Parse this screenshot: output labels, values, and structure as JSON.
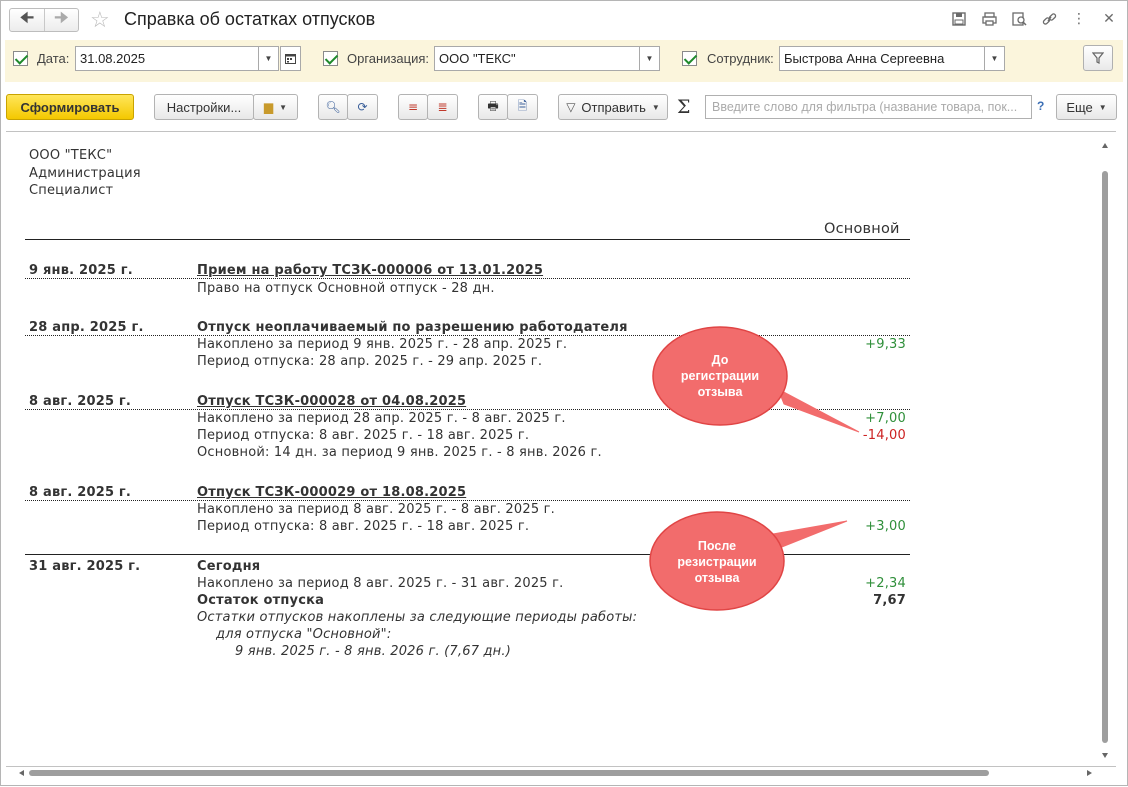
{
  "window": {
    "title": "Справка об остатках отпусков"
  },
  "filters": {
    "date_label": "Дата:",
    "date_value": "31.08.2025",
    "org_label": "Организация:",
    "org_value": "ООО \"ТЕКС\"",
    "employee_label": "Сотрудник:",
    "employee_value": "Быстрова Анна Сергеевна"
  },
  "toolbar": {
    "generate": "Сформировать",
    "settings": "Настройки...",
    "send": "Отправить",
    "search_placeholder": "Введите слово для фильтра (название товара, пок...",
    "help": "?",
    "more": "Еще"
  },
  "report": {
    "header": [
      "ООО \"ТЕКС\"",
      "Администрация",
      "Специалист"
    ],
    "column_title": "Основной",
    "entries": [
      {
        "date": "9 янв. 2025 г.",
        "title": "Прием на работу ТСЗК-000006 от 13.01.2025",
        "lines": [
          "Право на отпуск Основной отпуск - 28 дн."
        ]
      },
      {
        "date": "28 апр. 2025 г.",
        "title": "Отпуск неоплачиваемый по разрешению работодателя",
        "lines": [
          "Накоплено за период 9 янв. 2025 г. - 28 апр. 2025 г.",
          "Период отпуска: 28 апр. 2025 г. - 29 апр. 2025 г."
        ],
        "values": [
          "+9,33"
        ]
      },
      {
        "date": "8 авг. 2025 г.",
        "title": "Отпуск ТСЗК-000028 от 04.08.2025",
        "lines": [
          "Накоплено за период 28 апр. 2025 г. - 8 авг. 2025 г.",
          "Период отпуска: 8 авг. 2025 г. - 18 авг. 2025 г.",
          "Основной: 14 дн. за период 9 янв. 2025 г. - 8 янв. 2026 г."
        ],
        "values": [
          "+7,00",
          "-14,00"
        ]
      },
      {
        "date": "8 авг. 2025 г.",
        "title": "Отпуск ТСЗК-000029 от 18.08.2025",
        "lines": [
          "Накоплено за период 8 авг. 2025 г. - 8 авг. 2025 г.",
          "Период отпуска: 8 авг. 2025 г. - 18 авг. 2025 г."
        ],
        "values": [
          "+3,00"
        ]
      },
      {
        "date": "31 авг. 2025 г.",
        "title": "Сегодня",
        "lines": [
          "Накоплено за период 8 авг. 2025 г. - 31 авг. 2025 г."
        ],
        "values": [
          "+2,34"
        ],
        "remainder_label": "Остаток отпуска",
        "remainder_value": "7,67",
        "notes": [
          "Остатки отпусков накоплены за следующие периоды работы:",
          "для отпуска \"Основной\":",
          "9 янв. 2025 г. - 8 янв. 2026 г. (7,67 дн.)"
        ]
      }
    ]
  },
  "annotations": {
    "before": [
      "До",
      "регистрации",
      "отзыва"
    ],
    "after": [
      "После",
      "резистрации",
      "отзыва"
    ]
  },
  "colors": {
    "positive": "#2f8f3a",
    "negative": "#cc2222",
    "callout_fill": "#f26c6c",
    "primary_button": "#f4c800",
    "filter_bg": "#fbf5dc"
  }
}
